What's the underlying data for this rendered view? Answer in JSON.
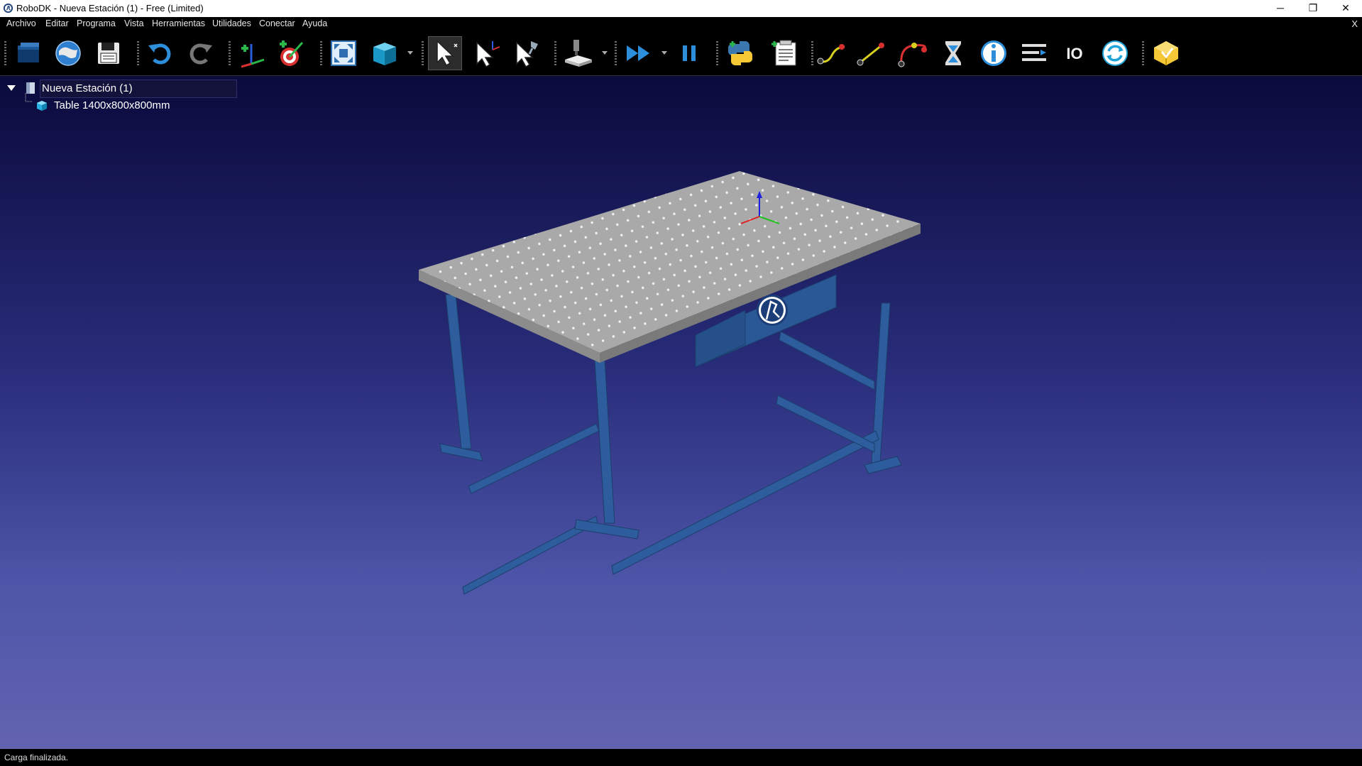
{
  "window": {
    "title": "RoboDK - Nueva Estación (1) - Free (Limited)",
    "minimize": "─",
    "maximize": "❐",
    "close": "✕"
  },
  "menu": {
    "items": [
      "Archivo",
      "Editar",
      "Programa",
      "Vista",
      "Herramientas",
      "Utilidades",
      "Conectar",
      "Ayuda"
    ],
    "close": "X"
  },
  "toolbar": {
    "buttons": [
      "open-station-icon",
      "online-library-icon",
      "save-icon",
      "undo-icon",
      "redo-icon",
      "add-reference-frame-icon",
      "add-target-icon",
      "fit-all-icon",
      "view-cube-icon",
      "select-icon",
      "move-reference-icon",
      "move-tool-icon",
      "add-machining-project-icon",
      "run-simulation-icon",
      "pause-icon",
      "add-python-program-icon",
      "add-program-icon",
      "move-joint-icon",
      "move-linear-icon",
      "move-circular-icon",
      "pause-instruction-icon",
      "message-icon",
      "program-call-icon",
      "io-icon",
      "refresh-icon",
      "add-in-icon"
    ],
    "accent": "#1fa3d8",
    "io_label": "IO"
  },
  "tree": {
    "root": "Nueva Estación (1)",
    "items": [
      {
        "label": "Table 1400x800x800mm",
        "icon": "object-icon"
      }
    ]
  },
  "viewport": {
    "object_name": "Table 1400x800x800mm",
    "background_top": "#0a0a3c",
    "background_bottom": "#6363b0",
    "table_top_color": "#a9a9a9",
    "frame_color": "#2d5d9c"
  },
  "status": {
    "text": "Carga finalizada."
  }
}
